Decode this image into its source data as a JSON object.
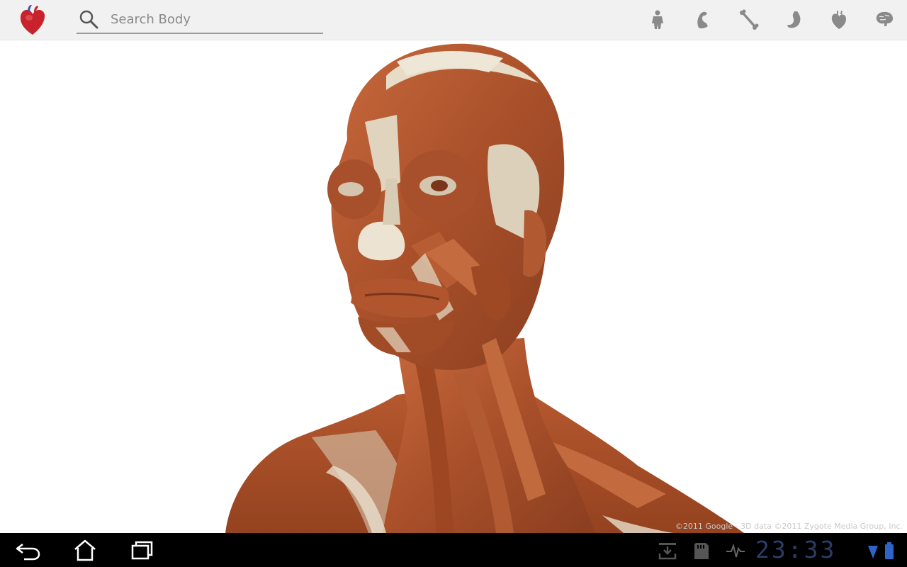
{
  "app": {
    "logo_icon": "heart-icon"
  },
  "search": {
    "placeholder": "Search Body",
    "value": ""
  },
  "layers": [
    {
      "name": "skin-layer",
      "icon": "body-silhouette-icon"
    },
    {
      "name": "muscle-layer",
      "icon": "muscle-icon"
    },
    {
      "name": "skeleton-layer",
      "icon": "bone-icon"
    },
    {
      "name": "organs-layer",
      "icon": "stomach-icon"
    },
    {
      "name": "circulatory-layer",
      "icon": "heart-outline-icon"
    },
    {
      "name": "nervous-layer",
      "icon": "brain-icon"
    }
  ],
  "viewport": {
    "copyright": "©2011 Google - 3D data ©2011 Zygote Media Group, Inc."
  },
  "systembar": {
    "clock": "23:33",
    "nav": [
      "back-icon",
      "home-icon",
      "recent-apps-icon"
    ],
    "status_icons": [
      "download-icon",
      "sd-card-icon",
      "activity-icon",
      "wifi-icon",
      "battery-icon"
    ]
  },
  "colors": {
    "topbar": "#f1f1f1",
    "muscle": "#b5572f",
    "tendon": "#e8dfcf",
    "clock": "#2b3d66"
  }
}
